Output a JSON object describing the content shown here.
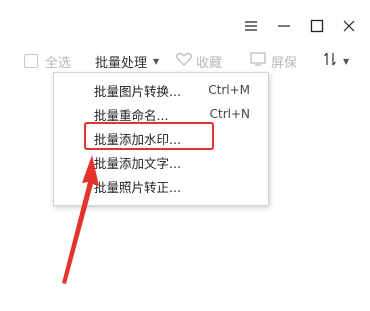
{
  "window_controls": {
    "menu_icon": "hamburger-icon",
    "minimize_icon": "minimize-icon",
    "maximize_icon": "maximize-icon",
    "close_icon": "close-icon"
  },
  "toolbar": {
    "select_all_label": "全选",
    "batch_label": "批量处理",
    "favorite_label": "收藏",
    "screensaver_label": "屏保",
    "sort_icon": "sort-icon"
  },
  "menu": {
    "items": [
      {
        "label": "批量图片转换...",
        "shortcut": "Ctrl+M"
      },
      {
        "label": "批量重命名...",
        "shortcut": "Ctrl+N"
      },
      {
        "label": "批量添加水印...",
        "shortcut": ""
      },
      {
        "label": "批量添加文字...",
        "shortcut": ""
      },
      {
        "label": "批量照片转正...",
        "shortcut": ""
      }
    ]
  },
  "colors": {
    "highlight": "#e4332a",
    "disabled_text": "#b8b8b8"
  }
}
